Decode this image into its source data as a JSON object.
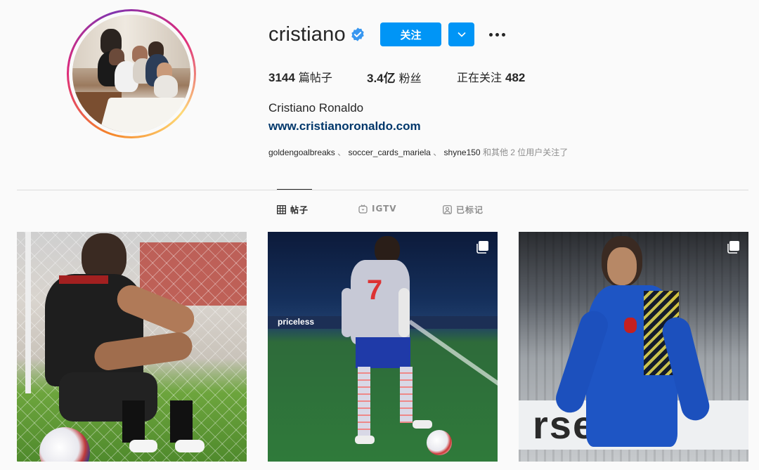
{
  "profile": {
    "username": "cristiano",
    "verified": true,
    "follow_label": "关注",
    "full_name": "Cristiano Ronaldo",
    "website": "www.cristianoronaldo.com"
  },
  "stats": {
    "posts_count": "3144",
    "posts_label": "篇帖子",
    "followers_count": "3.4亿",
    "followers_label": "粉丝",
    "following_label": "正在关注",
    "following_count": "482"
  },
  "followed_by": {
    "accounts": [
      "goldengoalbreaks",
      "soccer_cards_mariela",
      "shyne150"
    ],
    "separator": "、",
    "suffix": "和其他 2 位用户关注了"
  },
  "tabs": [
    {
      "label": "帖子",
      "icon": "grid-icon",
      "active": true
    },
    {
      "label": "IGTV",
      "icon": "igtv-icon",
      "active": false
    },
    {
      "label": "已标记",
      "icon": "tagged-icon",
      "active": false
    }
  ],
  "posts": [
    {
      "multi": false
    },
    {
      "multi": true,
      "board_text": "priceless"
    },
    {
      "multi": true,
      "sign_text": "rser"
    }
  ],
  "colors": {
    "accent": "#0095f6",
    "link": "#00376b",
    "muted": "#8e8e8e",
    "background": "#fafafa"
  }
}
